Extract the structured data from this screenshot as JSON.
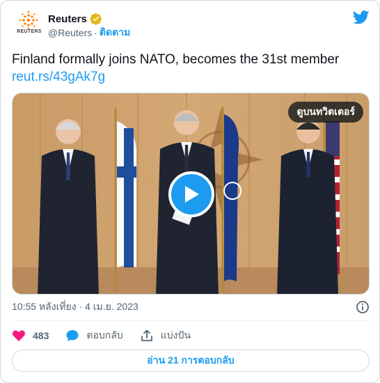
{
  "author": {
    "display_name": "Reuters",
    "handle": "@Reuters",
    "separator": "·",
    "follow_label": "ติดตาม",
    "logo_text": "REUTERS",
    "verified_color": "#e2b719"
  },
  "tweet": {
    "text": "Finland formally joins NATO, becomes the 31st member",
    "link": "reut.rs/43gAk7g"
  },
  "media": {
    "watch_on_twitter_label": "ดูบนทวิตเตอร์",
    "play_icon": "play-icon"
  },
  "meta": {
    "timestamp": "10:55 หลังเที่ยง · 4 เม.ย. 2023"
  },
  "actions": {
    "like_count": "483",
    "reply_label": "ตอบกลับ",
    "share_label": "แบ่งปัน"
  },
  "footer": {
    "read_replies_label": "อ่าน 21 การตอบกลับ"
  },
  "colors": {
    "accent": "#1d9bf0",
    "like": "#f91880",
    "text_secondary": "#536471"
  }
}
